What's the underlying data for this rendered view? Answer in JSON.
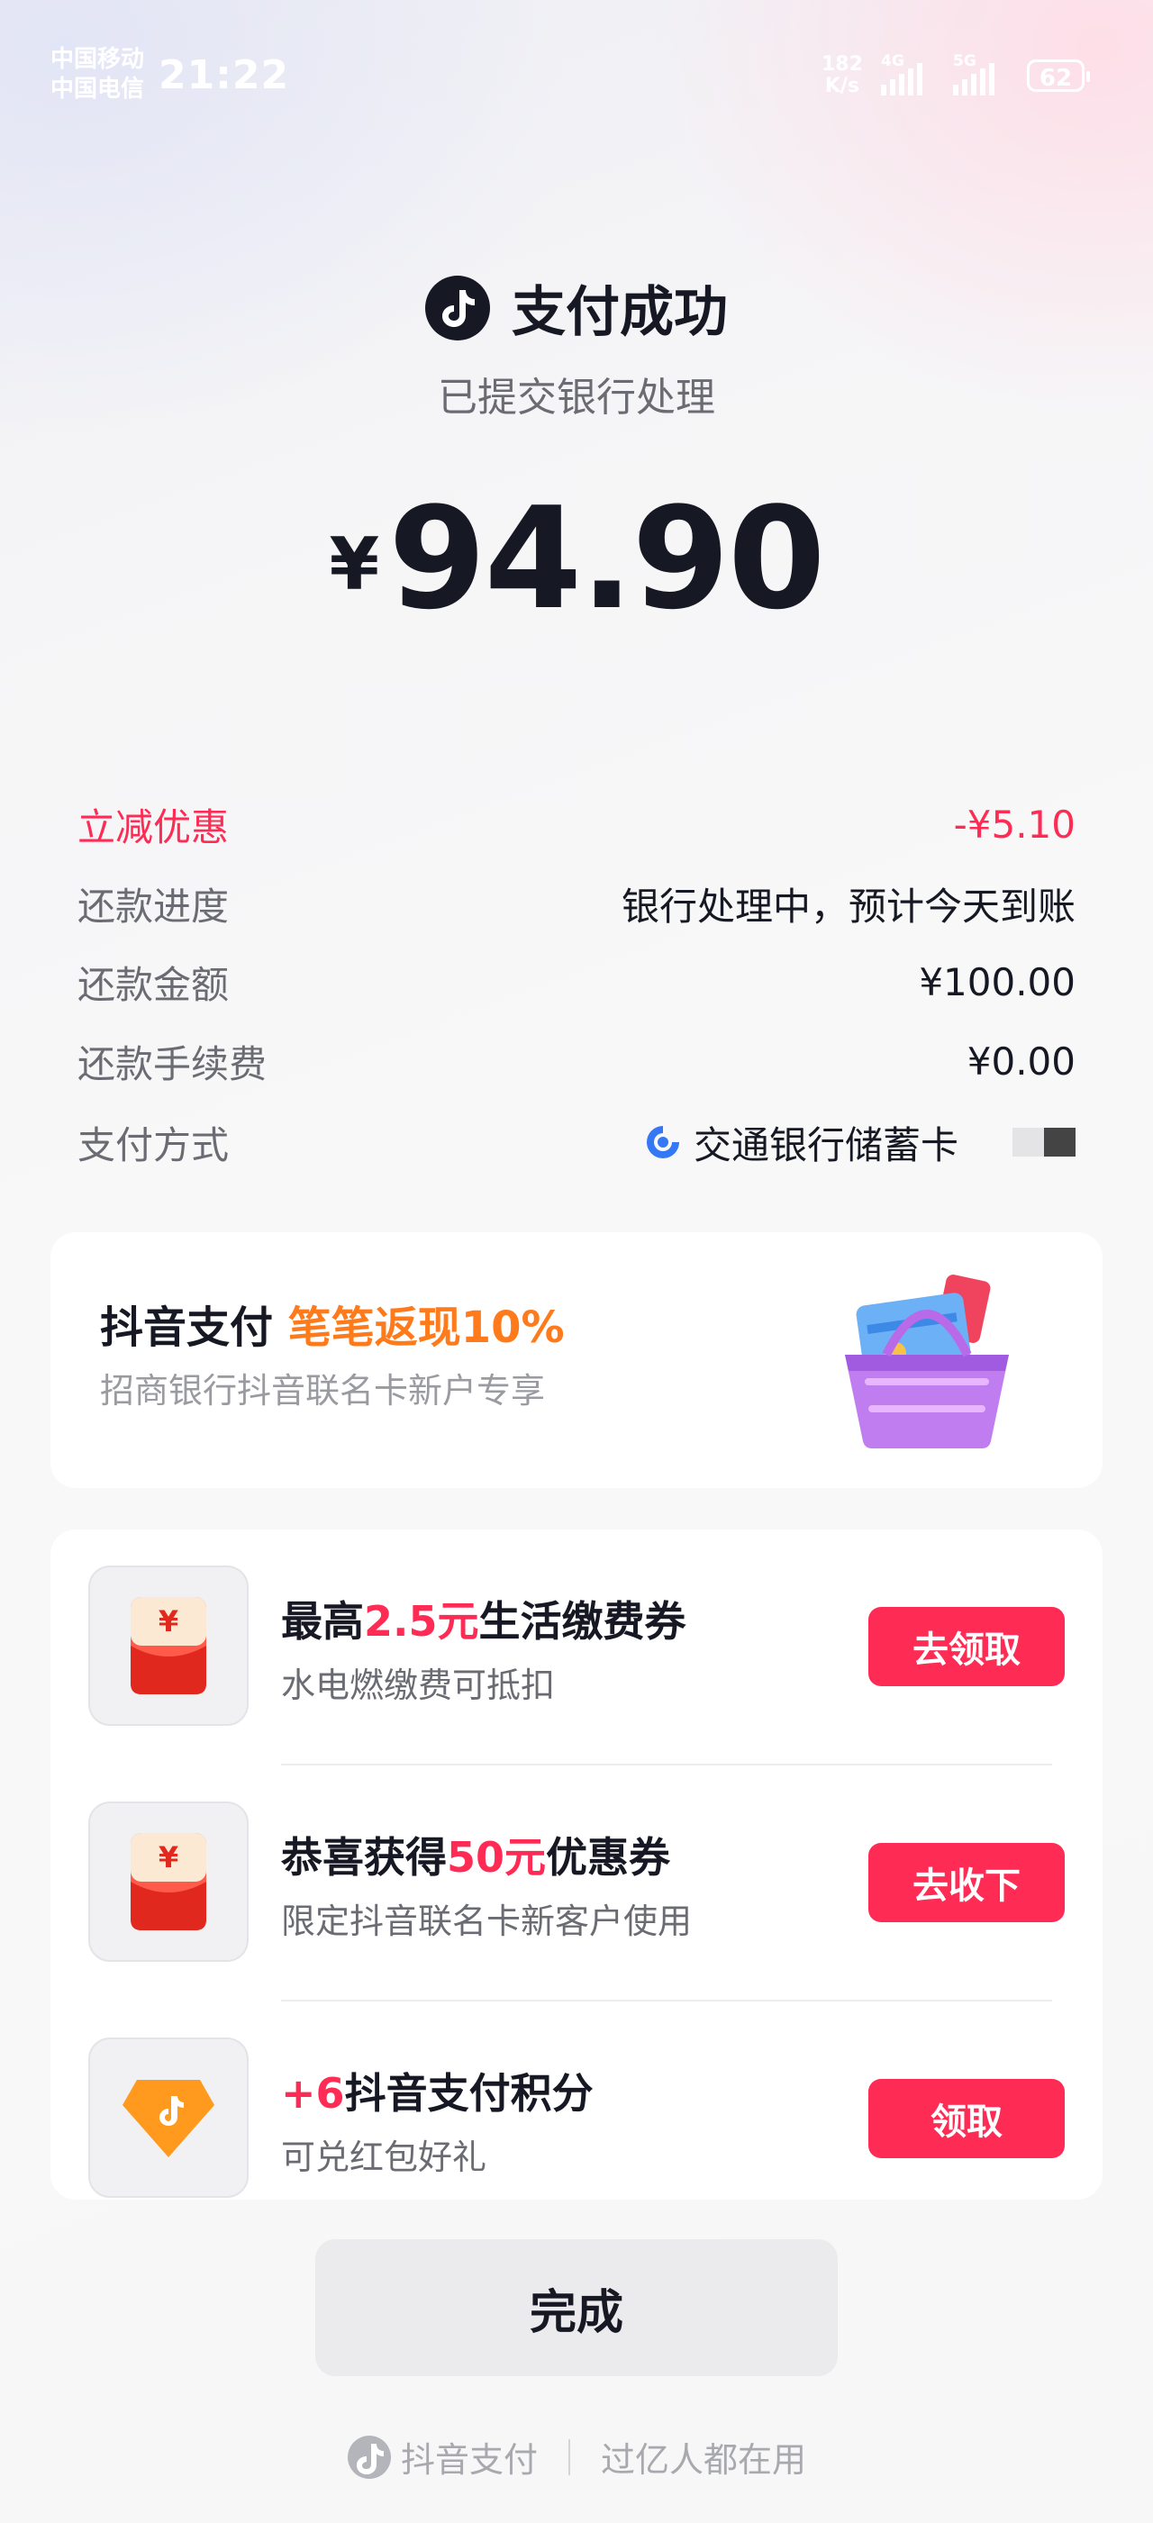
{
  "status_bar": {
    "carrier1": "中国移动",
    "carrier2": "中国电信",
    "time": "21:22",
    "net_speed_value": "182",
    "net_speed_unit": "K/s",
    "sig1_label": "4G",
    "sig2_label": "5G",
    "battery": "62"
  },
  "header": {
    "title": "支付成功",
    "subtitle": "已提交银行处理",
    "currency": "¥",
    "amount": "94.90"
  },
  "details": [
    {
      "label": "立减优惠",
      "value": "-¥5.10"
    },
    {
      "label": "还款进度",
      "value": "银行处理中，预计今天到账"
    },
    {
      "label": "还款金额",
      "value": "¥100.00"
    },
    {
      "label": "还款手续费",
      "value": "¥0.00"
    },
    {
      "label": "支付方式",
      "value": "交通银行储蓄卡"
    }
  ],
  "promo": {
    "title_prefix": "抖音支付",
    "title_highlight": "笔笔返现10%",
    "subtitle": "招商银行抖音联名卡新户专享"
  },
  "rewards": [
    {
      "title_prefix": "最高",
      "title_highlight": "2.5元",
      "title_suffix": "生活缴费券",
      "subtitle": "水电燃缴费可抵扣",
      "button": "去领取",
      "icon": "red-packet-icon"
    },
    {
      "title_prefix": "恭喜获得",
      "title_highlight": "50元",
      "title_suffix": "优惠券",
      "subtitle": "限定抖音联名卡新客户使用",
      "button": "去收下",
      "icon": "red-packet-icon"
    },
    {
      "title_prefix": "",
      "title_highlight": "+6",
      "title_suffix": "抖音支付积分",
      "subtitle": "可兑红包好礼",
      "button": "领取",
      "icon": "douyin-diamond-icon"
    }
  ],
  "done_button": "完成",
  "footer": {
    "brand": "抖音支付",
    "slogan": "过亿人都在用"
  },
  "colors": {
    "accent": "#fe2c55",
    "promo_highlight": "#ff7a1a",
    "text_primary": "#161823",
    "text_secondary": "#6b6c73"
  }
}
